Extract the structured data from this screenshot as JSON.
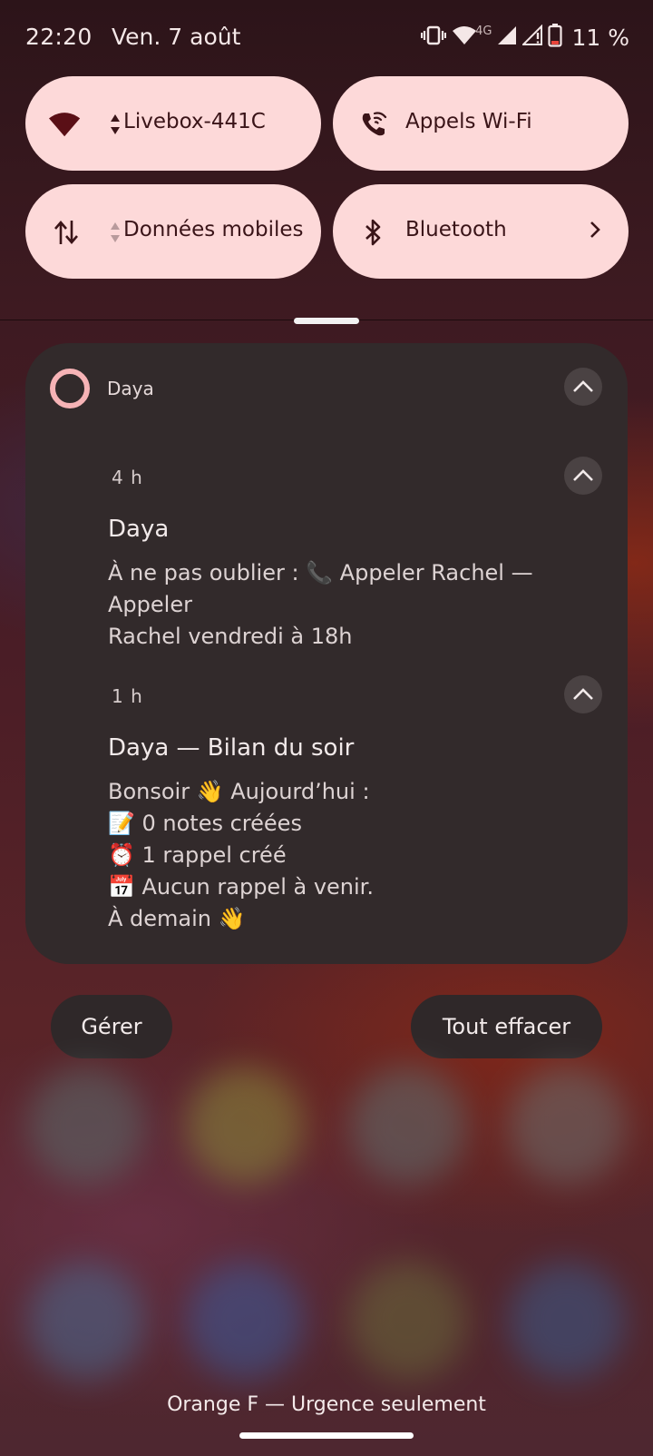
{
  "status_bar": {
    "time": "22:20",
    "date": "Ven. 7 août",
    "network_type": "4G",
    "battery": "11 %",
    "icons": [
      "vibrate-icon",
      "wifi-icon",
      "cell-signal-icon",
      "cell-signal-noservice-icon",
      "battery-low-icon"
    ]
  },
  "quick_settings": {
    "tiles": [
      {
        "label": "Livebox-441C",
        "icon": "wifi-icon"
      },
      {
        "label": "Appels Wi-Fi",
        "icon": "wifi-calling-icon"
      },
      {
        "label": "Données mobiles",
        "icon": "mobile-data-icon"
      },
      {
        "label": "Bluetooth",
        "icon": "bluetooth-icon"
      }
    ]
  },
  "notification_group": {
    "app_name": "Daya",
    "accent_color": "#f6b3b6",
    "notifications": [
      {
        "time": "4 h",
        "title": "Daya",
        "body_lines": [
          "À ne pas oublier : 📞 Appeler Rachel — Appeler",
          "Rachel vendredi à 18h"
        ]
      },
      {
        "time": "1 h",
        "title": "Daya — Bilan du soir",
        "body_lines": [
          "Bonsoir 👋 Aujourd’hui :",
          "📝 0 notes créées",
          "⏰ 1 rappel créé",
          "📅 Aucun rappel à venir.",
          "À demain 👋"
        ]
      }
    ]
  },
  "actions": {
    "manage": "Gérer",
    "clear_all": "Tout effacer"
  },
  "footer": {
    "carrier_status": "Orange F — Urgence seulement"
  },
  "colors": {
    "tile_bg": "#fdd9d9",
    "card_bg": "#322a2b"
  }
}
